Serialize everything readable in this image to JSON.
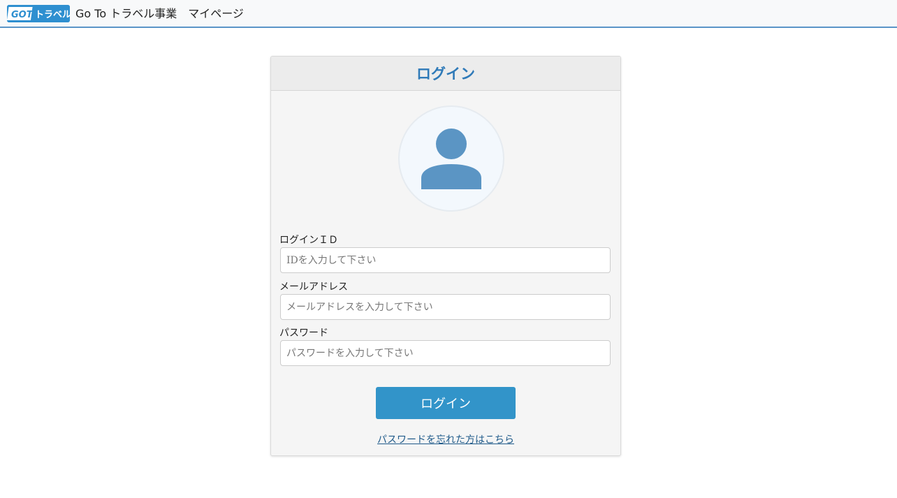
{
  "header": {
    "logo_text": "GOTO トラベル",
    "site_title": "Go To トラベル事業　マイページ"
  },
  "login_card": {
    "title": "ログイン",
    "avatar_icon": "user-icon",
    "fields": [
      {
        "label": "ログインＩＤ",
        "placeholder": "IDを入力して下さい",
        "value": ""
      },
      {
        "label": "メールアドレス",
        "placeholder": "メールアドレスを入力して下さい",
        "value": ""
      },
      {
        "label": "パスワード",
        "placeholder": "パスワードを入力して下さい",
        "value": ""
      }
    ],
    "submit_label": "ログイン",
    "forgot_password_link": "パスワードを忘れた方はこちら"
  },
  "colors": {
    "accent": "#3294c9",
    "title_blue": "#2f7ab8",
    "avatar_blue": "#5b95c4",
    "header_border": "#5b95c7"
  }
}
